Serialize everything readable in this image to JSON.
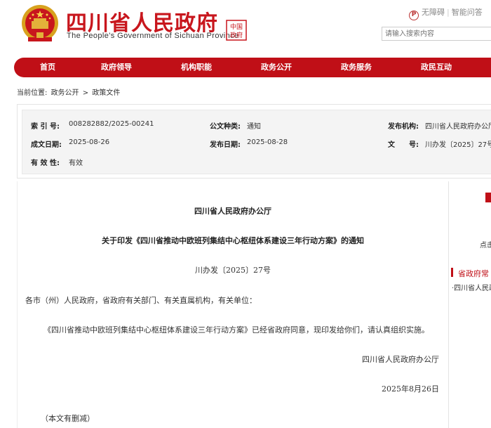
{
  "header": {
    "title_cn": "四川省人民政府",
    "title_en": "The People's Government of Sichuan Province",
    "seal_text": "中国政府",
    "top_links": [
      "无障碍",
      "智能问答"
    ],
    "search_placeholder": "请输入搜索内容"
  },
  "nav": {
    "items": [
      "首页",
      "政府领导",
      "机构职能",
      "政务公开",
      "政务服务",
      "政民互动"
    ]
  },
  "breadcrumb": {
    "label": "当前位置:",
    "items": [
      "政务公开",
      "政策文件"
    ],
    "separator": ">"
  },
  "meta": {
    "index_label": "索 引 号:",
    "index_value": "008282882/2025-00241",
    "category_label": "公文种类:",
    "category_value": "通知",
    "publisher_label": "发布机构:",
    "publisher_value": "四川省人民政府办公厅",
    "written_label": "成文日期:",
    "written_value": "2025-08-26",
    "published_label": "发布日期:",
    "published_value": "2025-08-28",
    "docno_label": "文　　号:",
    "docno_value": "川办发〔2025〕27号",
    "validity_label": "有 效 性:",
    "validity_value": "有效"
  },
  "article": {
    "issuer": "四川省人民政府办公厅",
    "title": "关于印发《四川省推动中欧班列集结中心枢纽体系建设三年行动方案》的通知",
    "doc_number": "川办发〔2025〕27号",
    "recipients": "各市（州）人民政府，省政府有关部门、有关直属机构，有关单位：",
    "body": "《四川省推动中欧班列集结中心枢纽体系建设三年行动方案》已经省政府同意，现印发给你们，请认真组织实施。",
    "signature": "四川省人民政府办公厅",
    "date": "2025年8月26日",
    "note": "（本文有删减）"
  },
  "sidebar": {
    "text_1": "点击",
    "section_title": "省政府常",
    "link_1": "·四川省人民政"
  },
  "colors": {
    "brand_red": "#c00f17",
    "title_red": "#c8161d"
  }
}
